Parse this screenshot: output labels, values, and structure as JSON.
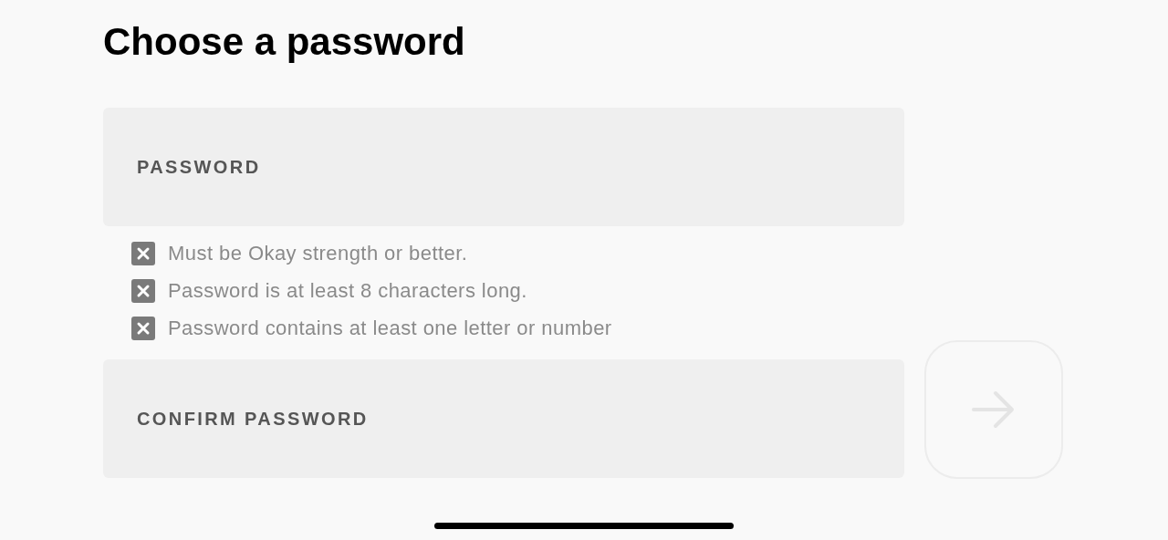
{
  "title": "Choose a password",
  "password_field": {
    "placeholder": "PASSWORD"
  },
  "requirements": [
    {
      "text": "Must be Okay strength or better.",
      "met": false
    },
    {
      "text": "Password is at least 8 characters long.",
      "met": false
    },
    {
      "text": "Password contains at least one letter or number",
      "met": false
    }
  ],
  "confirm_field": {
    "placeholder": "CONFIRM PASSWORD"
  },
  "next_button": {
    "disabled": true
  }
}
